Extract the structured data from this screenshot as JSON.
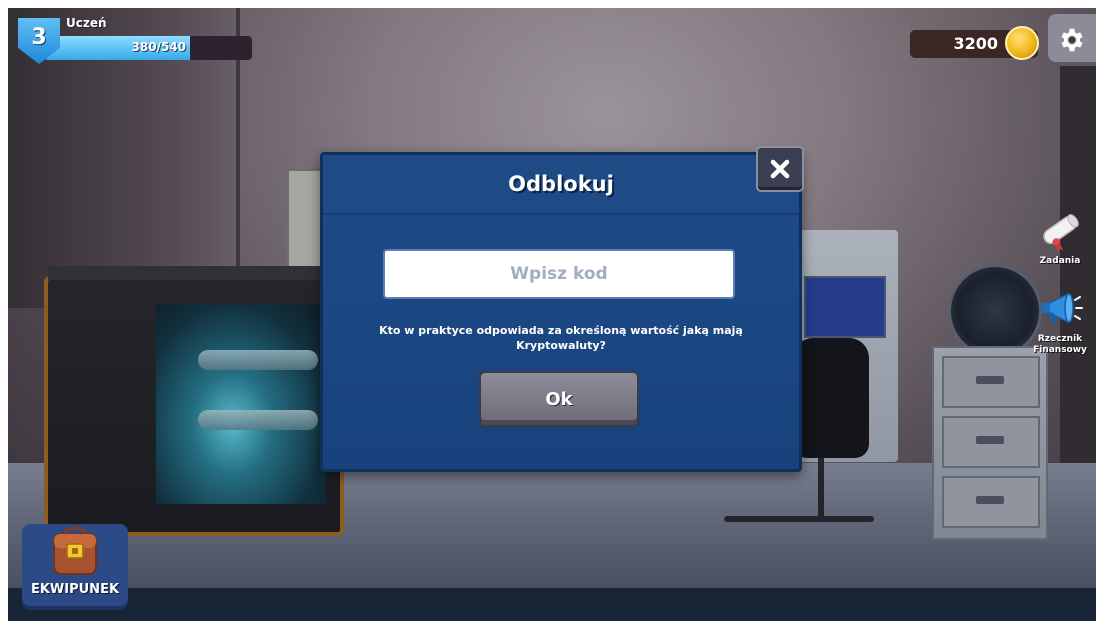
{
  "player": {
    "level": "3",
    "rank": "Uczeń",
    "xp_text": "380/540",
    "xp_progress": 0.7037
  },
  "currency": {
    "coins": "3200",
    "icon": "gold-coin-icon"
  },
  "settings": {
    "icon": "gear-icon"
  },
  "side_menu": [
    {
      "label": "Zadania",
      "icon": "diploma-scroll-icon"
    },
    {
      "label": "Rzecznik Finansowy",
      "icon": "megaphone-icon"
    }
  ],
  "inventory": {
    "label": "EKWIPUNEK",
    "icon": "backpack-icon"
  },
  "dialog": {
    "title": "Odblokuj",
    "input_placeholder": "Wpisz kod",
    "input_value": "",
    "question": "Kto w praktyce odpowiada za określoną wartość jaką mają Kryptowaluty?",
    "ok_label": "Ok",
    "close_icon": "close-icon"
  },
  "colors": {
    "dialog_bg": "#1f4c8a",
    "xp_fill": "#36a8ea",
    "coin": "#f2b51c",
    "button_gray": "#8f8c9a",
    "inventory_bg": "#2c4a86"
  }
}
